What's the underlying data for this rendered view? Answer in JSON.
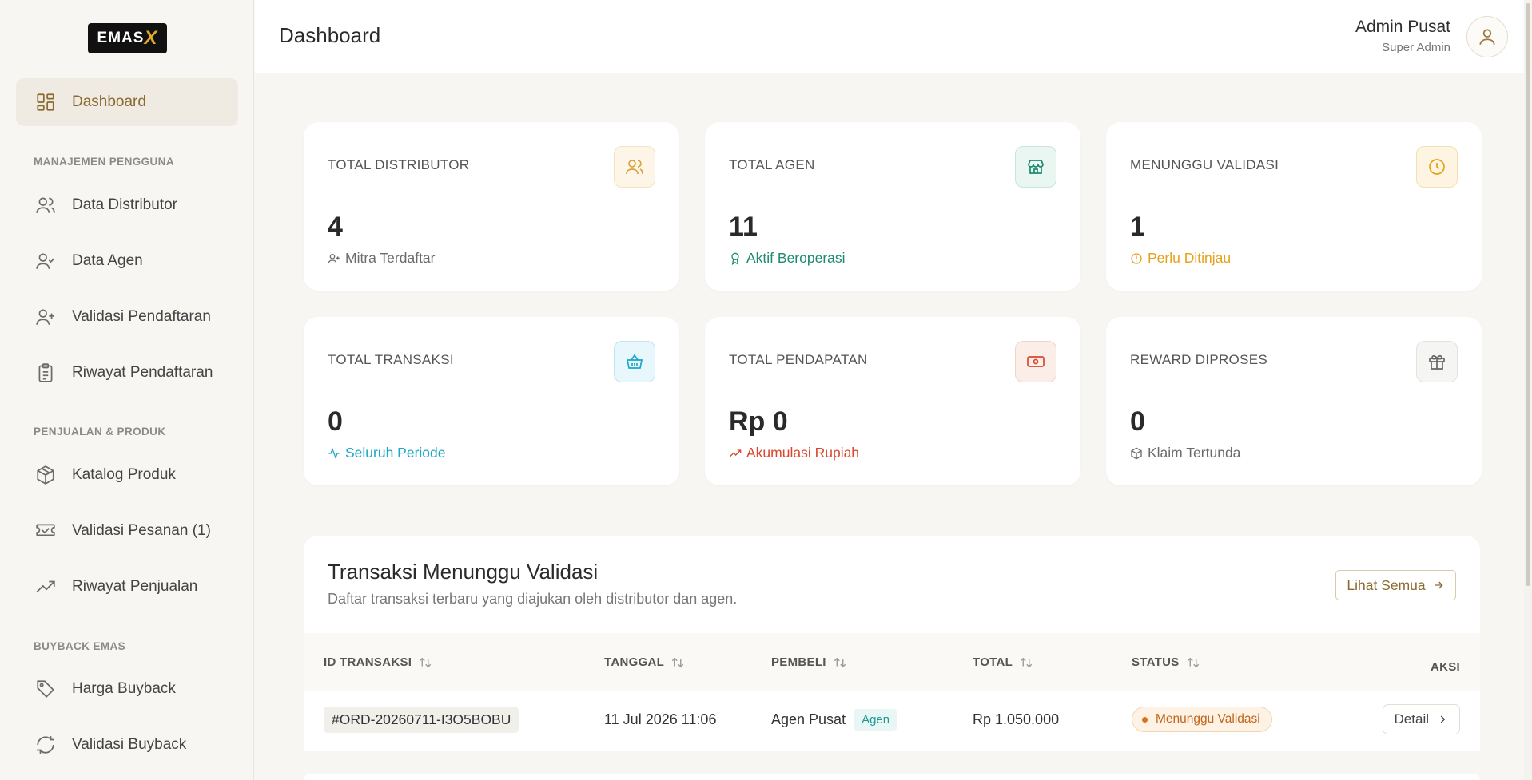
{
  "app": {
    "logo_text": "EMAS",
    "logo_accent": "X",
    "brand_color": "#8a6a30"
  },
  "sidebar": {
    "dashboard": "Dashboard",
    "sections": {
      "users": "MANAJEMEN PENGGUNA",
      "sales": "PENJUALAN & PRODUK",
      "buyback": "BUYBACK EMAS"
    },
    "items": {
      "distributor": "Data Distributor",
      "agen": "Data Agen",
      "validasi_pendaftaran": "Validasi Pendaftaran",
      "riwayat_pendaftaran": "Riwayat Pendaftaran",
      "katalog": "Katalog Produk",
      "validasi_pesanan": "Validasi Pesanan (1)",
      "riwayat_penjualan": "Riwayat Penjualan",
      "harga_buyback": "Harga Buyback",
      "validasi_buyback": "Validasi Buyback"
    }
  },
  "header": {
    "title": "Dashboard",
    "user_name": "Admin Pusat",
    "user_role": "Super Admin"
  },
  "stats": [
    {
      "label": "TOTAL DISTRIBUTOR",
      "value": "4",
      "sub": "Mitra Terdaftar",
      "sub_color": "#6b6b6b",
      "icon": "users-icon"
    },
    {
      "label": "TOTAL AGEN",
      "value": "11",
      "sub": "Aktif Beroperasi",
      "sub_color": "#1e8a6f",
      "icon": "store-icon"
    },
    {
      "label": "MENUNGGU VALIDASI",
      "value": "1",
      "sub": "Perlu Ditinjau",
      "sub_color": "#e3a21a",
      "icon": "clock-icon"
    },
    {
      "label": "TOTAL TRANSAKSI",
      "value": "0",
      "sub": "Seluruh Periode",
      "sub_color": "#1aa7c8",
      "icon": "basket-icon"
    },
    {
      "label": "TOTAL PENDAPATAN",
      "value": "Rp 0",
      "sub": "Akumulasi Rupiah",
      "sub_color": "#d9472f",
      "icon": "money-icon"
    },
    {
      "label": "REWARD DIPROSES",
      "value": "0",
      "sub": "Klaim Tertunda",
      "sub_color": "#6b6b6b",
      "icon": "gift-icon"
    }
  ],
  "transactions": {
    "title": "Transaksi Menunggu Validasi",
    "description": "Daftar transaksi terbaru yang diajukan oleh distributor dan agen.",
    "see_all": "Lihat Semua",
    "columns": {
      "id": "ID TRANSAKSI",
      "date": "TANGGAL",
      "buyer": "PEMBELI",
      "total": "TOTAL",
      "status": "STATUS",
      "action": "AKSI"
    },
    "rows": [
      {
        "id": "#ORD-20260711-I3O5BOBU",
        "date": "11 Jul 2026 11:06",
        "buyer": "Agen Pusat",
        "buyer_tag": "Agen",
        "total": "Rp 1.050.000",
        "status": "Menunggu Validasi",
        "action": "Detail"
      }
    ]
  }
}
